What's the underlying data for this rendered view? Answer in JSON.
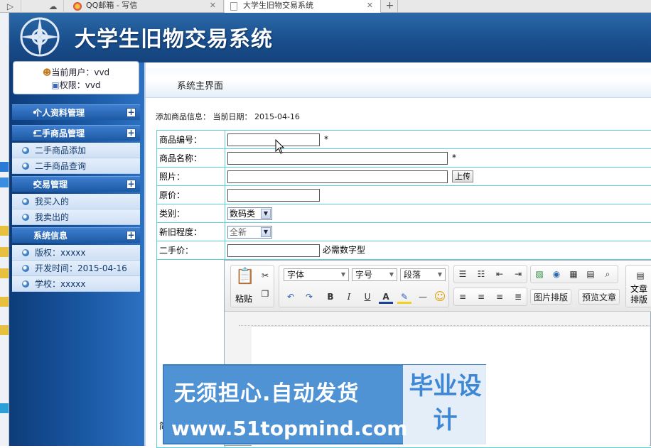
{
  "browser": {
    "tabs": [
      {
        "title": "QQ邮箱 - 写信",
        "active": false
      },
      {
        "title": "大学生旧物交易系统",
        "active": true
      }
    ],
    "new_tab": "+"
  },
  "site": {
    "title": "大学生旧物交易系统"
  },
  "user": {
    "current_user": "当前用户：vvd",
    "permission": "权限：vvd"
  },
  "sidebar": {
    "sections": [
      {
        "title": "个人资料管理",
        "items": []
      },
      {
        "title": "二手商品管理",
        "items": [
          "二手商品添加",
          "二手商品查询"
        ]
      },
      {
        "title": "交易管理",
        "items": [
          "我买入的",
          "我卖出的"
        ]
      },
      {
        "title": "系统信息",
        "items": [
          "版权：xxxxx",
          "开发时间：2015-04-16",
          "学校：xxxxx"
        ]
      }
    ],
    "star": "•",
    "plus": "+"
  },
  "main": {
    "header": "系统主界面",
    "date_line": "添加商品信息： 当前日期： 2015-04-16"
  },
  "form": {
    "fields": [
      {
        "label": "商品编号：",
        "value": "",
        "required": "*"
      },
      {
        "label": "商品名称：",
        "value": "",
        "required": "*"
      },
      {
        "label": "照片：",
        "value": "",
        "button": "上传"
      },
      {
        "label": "原价：",
        "value": ""
      },
      {
        "label": "类别：",
        "select": "数码类"
      },
      {
        "label": "新旧程度：",
        "select": "全新"
      },
      {
        "label": "二手价：",
        "value": "",
        "hint": "必需数字型"
      }
    ],
    "last_label": "简"
  },
  "editor": {
    "paste": "粘贴",
    "font": "字体",
    "size": "字号",
    "paragraph": "段落",
    "bold": "B",
    "italic": "I",
    "underline": "U",
    "font_color": "A",
    "image_layout": "图片排版",
    "preview": "预览文章",
    "article_layout": "文章排版"
  },
  "ad": {
    "line1": "无须担心.自动发货",
    "line2": "www.51topmind.com",
    "box": "毕业设计"
  },
  "colors": {
    "banner": "#1a4f8d",
    "table_border": "#5ccfd8",
    "sidebar_section": "#1d5aa5"
  }
}
